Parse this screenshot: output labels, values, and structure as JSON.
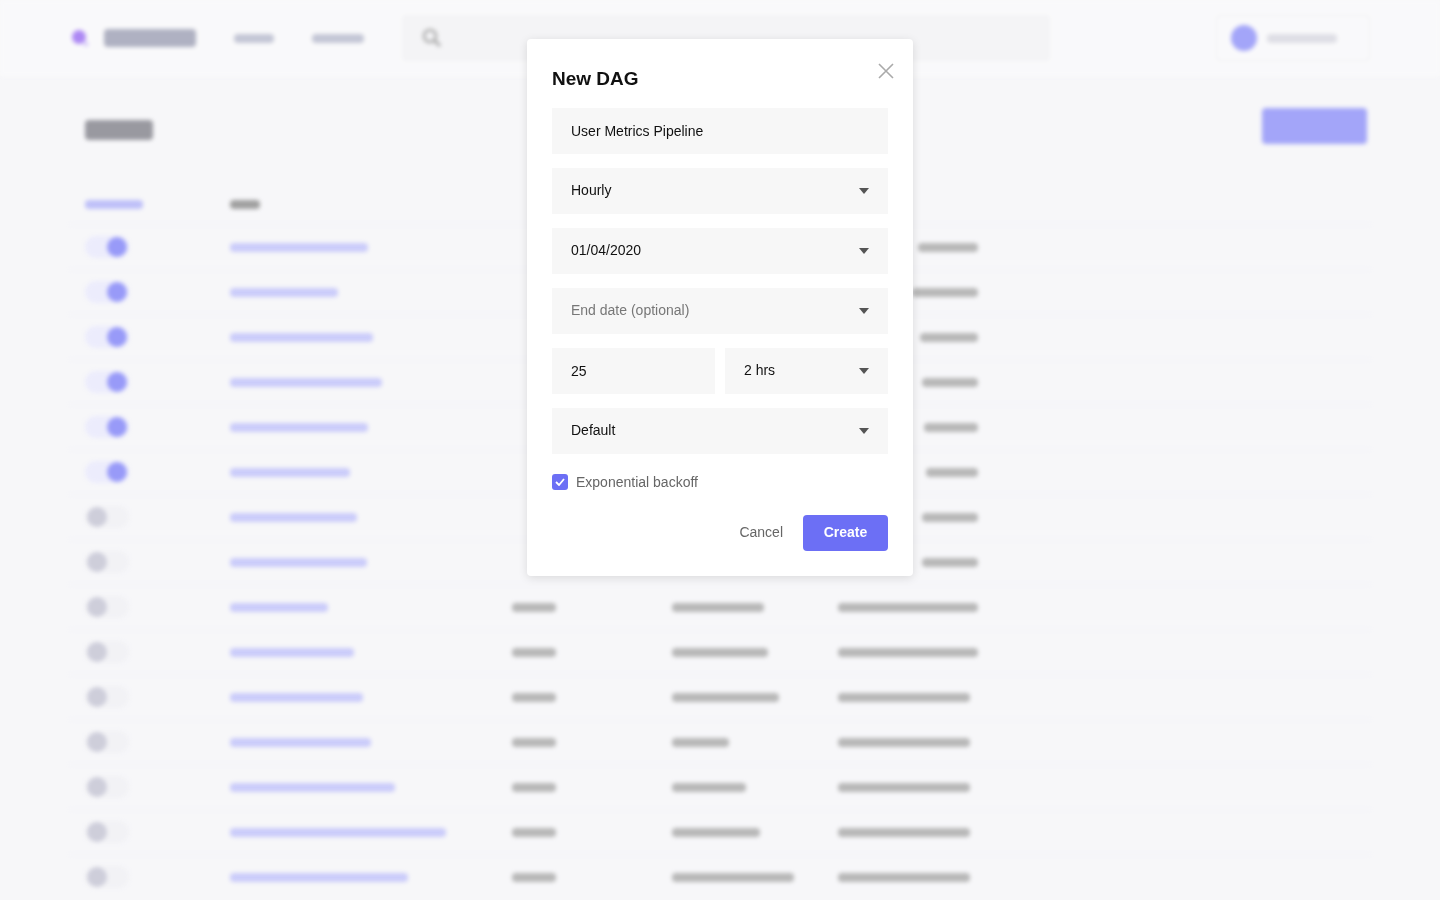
{
  "backdrop": {
    "rows": [
      {
        "on": true
      },
      {
        "on": true
      },
      {
        "on": true
      },
      {
        "on": true
      },
      {
        "on": true
      },
      {
        "on": true
      },
      {
        "on": false
      },
      {
        "on": false
      },
      {
        "on": false
      },
      {
        "on": false
      },
      {
        "on": false
      },
      {
        "on": false
      },
      {
        "on": false
      },
      {
        "on": false
      },
      {
        "on": false
      }
    ]
  },
  "dialog": {
    "title": "New DAG",
    "fields": [
      {
        "kind": "input",
        "value": "User Metrics Pipeline"
      },
      {
        "kind": "select",
        "value": "Hourly"
      },
      {
        "kind": "select",
        "value": "01/04/2020"
      },
      {
        "kind": "select",
        "placeholder": "End date (optional)"
      },
      {
        "kind": "group",
        "items": [
          {
            "kind": "input",
            "value": "25"
          },
          {
            "kind": "select",
            "value": "2 hrs"
          }
        ]
      },
      {
        "kind": "select",
        "value": "Default"
      }
    ],
    "checkbox": {
      "label": "Exponential backoff",
      "checked": true
    },
    "buttons": [
      {
        "kind": "text",
        "label": "Cancel"
      },
      {
        "kind": "primary",
        "label": "Create"
      }
    ]
  }
}
